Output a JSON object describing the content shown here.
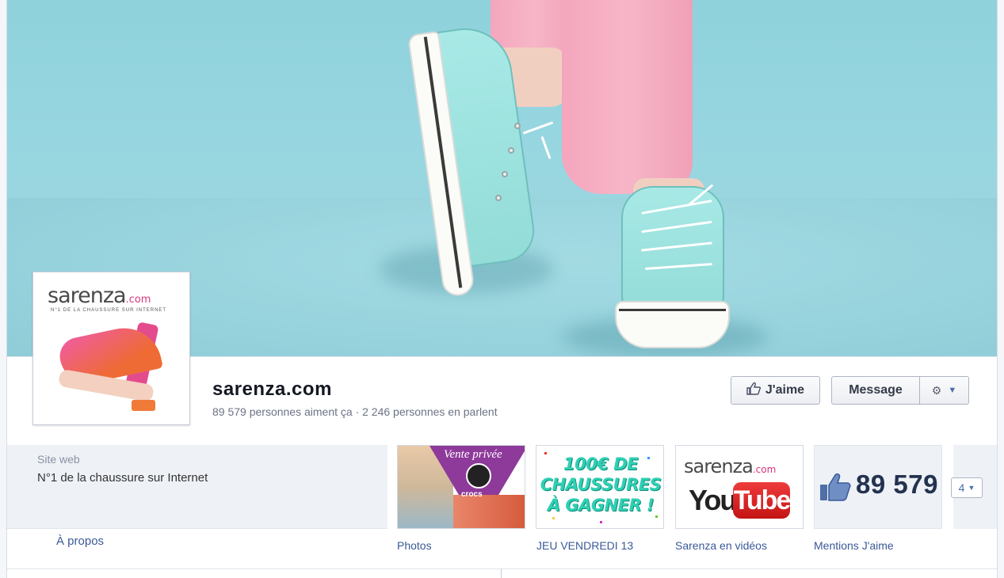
{
  "page": {
    "name": "sarenza.com",
    "stats": "89 579 personnes aiment ça · 2 246 personnes en parlent"
  },
  "profile": {
    "logo_main": "sarenza",
    "logo_suffix": ".com",
    "logo_tagline": "N°1 DE LA CHAUSSURE SUR INTERNET"
  },
  "actions": {
    "like_label": "J'aime",
    "message_label": "Message"
  },
  "info": {
    "label": "Site web",
    "value": "N°1 de la chaussure sur Internet",
    "about_link": "À propos"
  },
  "apps": [
    {
      "caption": "Photos",
      "tile_title": "Vente privée",
      "tile_brand": "crocs"
    },
    {
      "caption": "JEU VENDREDI 13",
      "tile_text": "100€ DE CHAUSSURES À GAGNER !"
    },
    {
      "caption": "Sarenza en vidéos",
      "tile_logo": "sarenza",
      "tile_logo_suffix": ".com",
      "tile_you": "You",
      "tile_tube": "Tube"
    },
    {
      "caption": "Mentions J'aime",
      "count": "89 579"
    }
  ],
  "more_button": "4",
  "colors": {
    "link": "#3b5998",
    "cover_bg": "#94d4de",
    "brand_pink": "#d9357d"
  },
  "icons": {
    "like": "thumbs-up-icon",
    "gear": "gear-icon",
    "dropdown": "chevron-down-icon"
  }
}
